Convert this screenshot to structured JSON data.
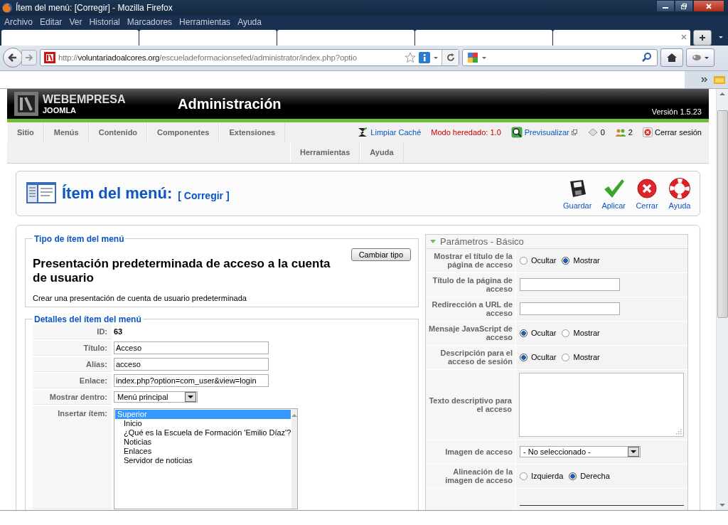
{
  "window": {
    "title": "Ítem del menú: [Corregir] - Mozilla Firefox"
  },
  "menu_bar": [
    "Archivo",
    "Editar",
    "Ver",
    "Historial",
    "Marcadores",
    "Herramientas",
    "Ayuda"
  ],
  "address_bar": {
    "scheme": "http://",
    "host": "voluntariadoalcores.org",
    "path": "/escueladeformacionsefed/administrator/index.php?optio"
  },
  "header": {
    "brand": "WEBEMPRESA",
    "brand_sub": "JOOMLA",
    "title": "Administración",
    "version": "Versión 1.5.23"
  },
  "main_menu": {
    "row_1": [
      "Sitio",
      "Menús",
      "Contenido",
      "Componentes",
      "Extensiones"
    ],
    "row_2": [
      "Herramientas",
      "Ayuda"
    ]
  },
  "status": {
    "clear_cache": "Limpiar Caché",
    "legacy_mode": "Modo heredado: 1.0",
    "preview": "Previsualizar",
    "messages": "0",
    "users": "2",
    "logout": "Cerrar sesión"
  },
  "toolbar": {
    "title": "Ítem del menú:",
    "subtitle": "[ Corregir ]",
    "buttons": [
      {
        "kind": "save",
        "label": "Guardar"
      },
      {
        "kind": "apply",
        "label": "Aplicar"
      },
      {
        "kind": "cancel",
        "label": "Cerrar"
      },
      {
        "kind": "help",
        "label": "Ayuda"
      }
    ]
  },
  "type_section": {
    "legend": "Tipo de ítem del menú",
    "button": "Cambiar tipo",
    "heading": "Presentación predeterminada de acceso a la cuenta de usuario",
    "description": "Crear una presentación de cuenta de usuario predeterminada"
  },
  "details": {
    "legend": "Detalles del ítem del menú",
    "rows": [
      {
        "kind": "text",
        "label": "ID:",
        "value": "63"
      },
      {
        "kind": "input",
        "label": "Título:",
        "value": "Acceso"
      },
      {
        "kind": "input",
        "label": "Alías:",
        "value": "acceso"
      },
      {
        "kind": "input",
        "label": "Enlace:",
        "value": "index.php?option=com_user&view=login"
      },
      {
        "kind": "select",
        "label": "Mostrar dentro:",
        "value": "Menú principal"
      },
      {
        "kind": "listbox",
        "label": "Insertar ítem:",
        "options": [
          {
            "label": "Superior",
            "selected": true,
            "children": [
              {
                "label": "Inicio",
                "selected": false
              },
              {
                "label": "¿Qué es la Escuela de Formación 'Emilio Díaz'?",
                "selected": false
              },
              {
                "label": "Noticias",
                "selected": false
              },
              {
                "label": "Enlaces",
                "selected": false
              },
              {
                "label": "Servidor de noticias",
                "selected": false
              }
            ]
          }
        ]
      }
    ]
  },
  "parameters": {
    "title": "Parámetros - Básico",
    "expanded": true,
    "rows": [
      {
        "kind": "radio",
        "label": "Mostrar el título de la página de acceso",
        "options": [
          {
            "label": "Ocultar",
            "selected": false
          },
          {
            "label": "Mostrar",
            "selected": true
          }
        ]
      },
      {
        "kind": "input",
        "label": "Título de la página de acceso"
      },
      {
        "kind": "input",
        "label": "Redirección a URL de acceso"
      },
      {
        "kind": "radio",
        "label": "Mensaje JavaScript de acceso",
        "options": [
          {
            "label": "Ocultar",
            "selected": true
          },
          {
            "label": "Mostrar",
            "selected": false
          }
        ]
      },
      {
        "kind": "radio",
        "label": "Descripción para el acceso de sesión",
        "options": [
          {
            "label": "Ocultar",
            "selected": true
          },
          {
            "label": "Mostrar",
            "selected": false
          }
        ]
      },
      {
        "kind": "textarea",
        "label": "Texto descriptivo para el acceso"
      },
      {
        "kind": "select",
        "label": "Imagen de acceso",
        "value": "- No seleccionado -"
      },
      {
        "kind": "radio",
        "label": "Alineación de la imagen de acceso",
        "options": [
          {
            "label": "Izquierda",
            "selected": false
          },
          {
            "label": "Derecha",
            "selected": true
          }
        ]
      },
      {
        "kind": "rule"
      }
    ]
  }
}
